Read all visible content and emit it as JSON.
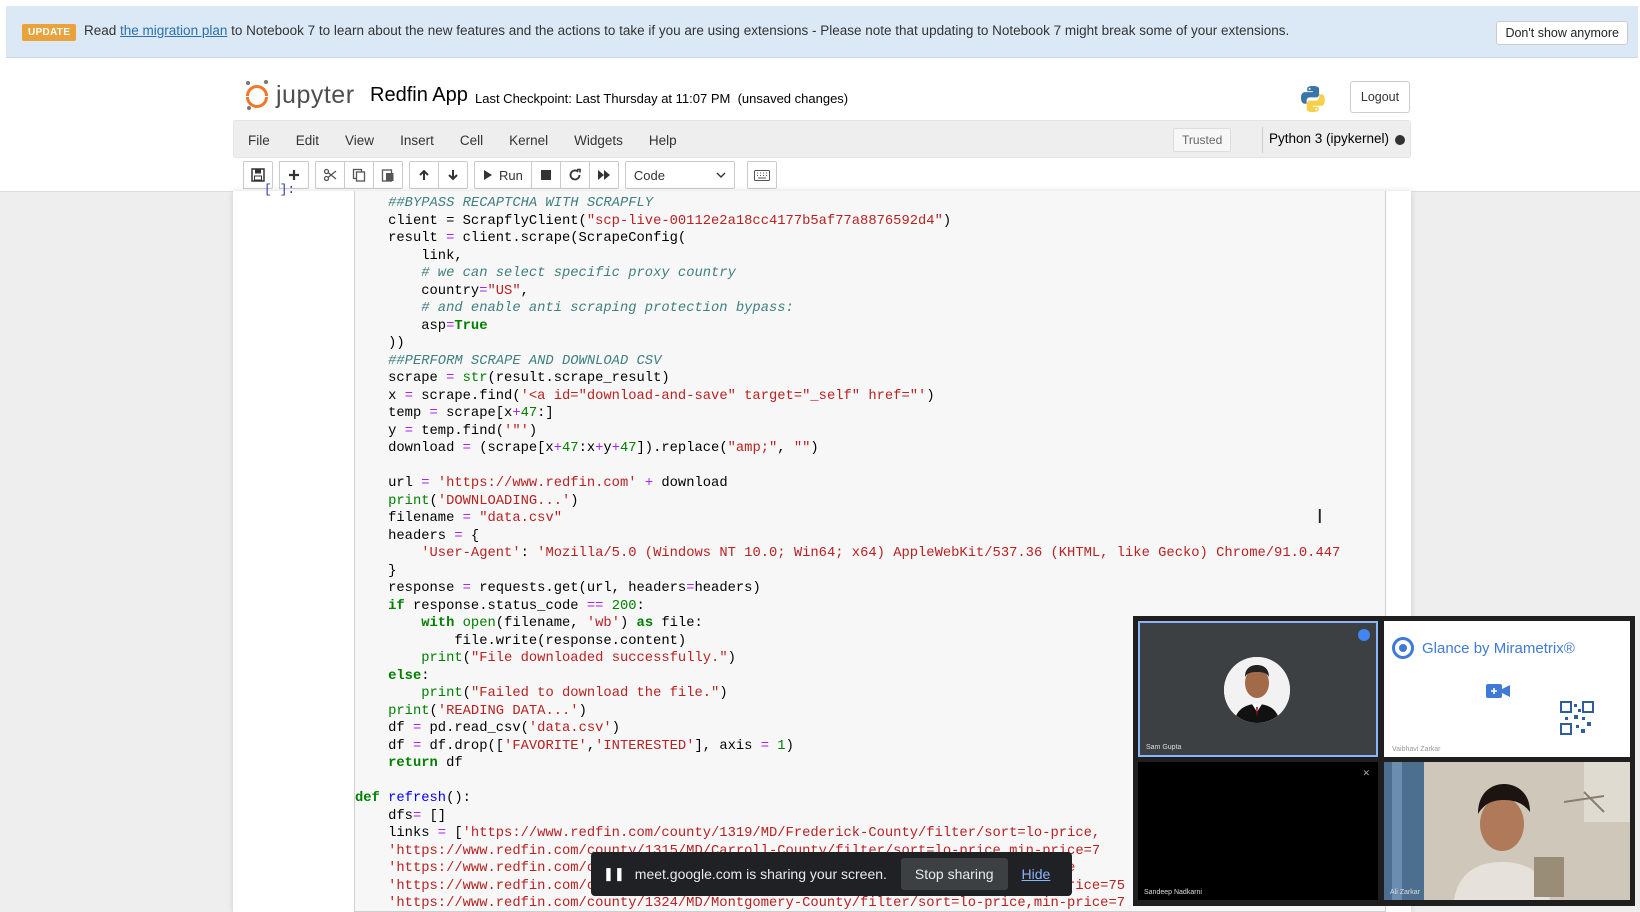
{
  "banner": {
    "badge": "UPDATE",
    "text_before": "Read ",
    "link_text": "the migration plan",
    "text_after": " to Notebook 7 to learn about the new features and the actions to take if you are using extensions - Please note that updating to Notebook 7 might break some of your extensions.",
    "dismiss_label": "Don't show anymore"
  },
  "header": {
    "logo_text": "jupyter",
    "notebook_name": "Redfin App",
    "checkpoint": "Last Checkpoint: Last Thursday at 11:07 PM",
    "unsaved": "(unsaved changes)",
    "logout_label": "Logout"
  },
  "menu": {
    "items": [
      "File",
      "Edit",
      "View",
      "Insert",
      "Cell",
      "Kernel",
      "Widgets",
      "Help"
    ],
    "trusted": "Trusted",
    "kernel": "Python 3 (ipykernel)"
  },
  "toolbar": {
    "run_label": "Run",
    "cell_type": "Code"
  },
  "cell": {
    "prompt": "[ ]:"
  },
  "code_lines": [
    [
      [
        "    ",
        ""
      ],
      [
        "##BYPASS RECAPTCHA WITH SCRAPFLY",
        "cm"
      ]
    ],
    [
      [
        "    client = ScrapflyClient(",
        ""
      ],
      [
        "\"scp-live-00112e2a18cc4177b5af77a8876592d4\"",
        "st"
      ],
      [
        ")",
        ""
      ]
    ],
    [
      [
        "    result ",
        ""
      ],
      [
        "=",
        "op"
      ],
      [
        " client.scrape(ScrapeConfig(",
        ""
      ]
    ],
    [
      [
        "        link,",
        ""
      ]
    ],
    [
      [
        "        ",
        ""
      ],
      [
        "# we can select specific proxy country",
        "cm"
      ]
    ],
    [
      [
        "        country",
        ""
      ],
      [
        "=",
        "op"
      ],
      [
        "\"US\"",
        "st"
      ],
      [
        ",",
        ""
      ]
    ],
    [
      [
        "        ",
        ""
      ],
      [
        "# and enable anti scraping protection bypass:",
        "cm"
      ]
    ],
    [
      [
        "        asp",
        ""
      ],
      [
        "=",
        "op"
      ],
      [
        "True",
        "kw"
      ]
    ],
    [
      [
        "    ))",
        ""
      ]
    ],
    [
      [
        "    ",
        ""
      ],
      [
        "##PERFORM SCRAPE AND DOWNLOAD CSV",
        "cm"
      ]
    ],
    [
      [
        "    scrape ",
        ""
      ],
      [
        "=",
        "op"
      ],
      [
        " ",
        ""
      ],
      [
        "str",
        "bi"
      ],
      [
        "(result.scrape_result)",
        ""
      ]
    ],
    [
      [
        "    x ",
        ""
      ],
      [
        "=",
        "op"
      ],
      [
        " scrape.find(",
        ""
      ],
      [
        "'<a id=\"download-and-save\" target=\"_self\" href=\"'",
        "st"
      ],
      [
        ")",
        ""
      ]
    ],
    [
      [
        "    temp ",
        ""
      ],
      [
        "=",
        "op"
      ],
      [
        " scrape[x",
        ""
      ],
      [
        "+",
        "op"
      ],
      [
        "47",
        "nu"
      ],
      [
        ":]",
        ""
      ]
    ],
    [
      [
        "    y ",
        ""
      ],
      [
        "=",
        "op"
      ],
      [
        " temp.find(",
        ""
      ],
      [
        "'\"'",
        "st"
      ],
      [
        ")",
        ""
      ]
    ],
    [
      [
        "    download ",
        ""
      ],
      [
        "=",
        "op"
      ],
      [
        " (scrape[x",
        ""
      ],
      [
        "+",
        "op"
      ],
      [
        "47",
        "nu"
      ],
      [
        ":x",
        ""
      ],
      [
        "+",
        "op"
      ],
      [
        "y",
        ""
      ],
      [
        "+",
        "op"
      ],
      [
        "47",
        "nu"
      ],
      [
        "]).replace(",
        ""
      ],
      [
        "\"amp;\"",
        "st"
      ],
      [
        ", ",
        ""
      ],
      [
        "\"\"",
        "st"
      ],
      [
        ")",
        ""
      ]
    ],
    [
      [
        "",
        ""
      ]
    ],
    [
      [
        "    url ",
        ""
      ],
      [
        "=",
        "op"
      ],
      [
        " ",
        ""
      ],
      [
        "'https://www.redfin.com'",
        "st"
      ],
      [
        " ",
        ""
      ],
      [
        "+",
        "op"
      ],
      [
        " download",
        ""
      ]
    ],
    [
      [
        "    ",
        ""
      ],
      [
        "print",
        "bi"
      ],
      [
        "(",
        ""
      ],
      [
        "'DOWNLOADING...'",
        "st"
      ],
      [
        ")",
        ""
      ]
    ],
    [
      [
        "    filename ",
        ""
      ],
      [
        "=",
        "op"
      ],
      [
        " ",
        ""
      ],
      [
        "\"data.csv\"",
        "st"
      ]
    ],
    [
      [
        "    headers ",
        ""
      ],
      [
        "=",
        "op"
      ],
      [
        " {",
        ""
      ]
    ],
    [
      [
        "        ",
        ""
      ],
      [
        "'User-Agent'",
        "st"
      ],
      [
        ": ",
        ""
      ],
      [
        "'Mozilla/5.0 (Windows NT 10.0; Win64; x64) AppleWebKit/537.36 (KHTML, like Gecko) Chrome/91.0.447",
        "st"
      ]
    ],
    [
      [
        "    }",
        ""
      ]
    ],
    [
      [
        "    response ",
        ""
      ],
      [
        "=",
        "op"
      ],
      [
        " requests.get(url, headers",
        ""
      ],
      [
        "=",
        "op"
      ],
      [
        "headers)",
        ""
      ]
    ],
    [
      [
        "    ",
        ""
      ],
      [
        "if",
        "kw"
      ],
      [
        " response.status_code ",
        ""
      ],
      [
        "==",
        "op"
      ],
      [
        " ",
        ""
      ],
      [
        "200",
        "nu"
      ],
      [
        ":",
        ""
      ]
    ],
    [
      [
        "        ",
        ""
      ],
      [
        "with",
        "kw"
      ],
      [
        " ",
        ""
      ],
      [
        "open",
        "bi"
      ],
      [
        "(filename, ",
        ""
      ],
      [
        "'wb'",
        "st"
      ],
      [
        ") ",
        ""
      ],
      [
        "as",
        "kw"
      ],
      [
        " file:",
        ""
      ]
    ],
    [
      [
        "            file.write(response.content)",
        ""
      ]
    ],
    [
      [
        "        ",
        ""
      ],
      [
        "print",
        "bi"
      ],
      [
        "(",
        ""
      ],
      [
        "\"File downloaded successfully.\"",
        "st"
      ],
      [
        ")",
        ""
      ]
    ],
    [
      [
        "    ",
        ""
      ],
      [
        "else",
        "kw"
      ],
      [
        ":",
        ""
      ]
    ],
    [
      [
        "        ",
        ""
      ],
      [
        "print",
        "bi"
      ],
      [
        "(",
        ""
      ],
      [
        "\"Failed to download the file.\"",
        "st"
      ],
      [
        ")",
        ""
      ]
    ],
    [
      [
        "    ",
        ""
      ],
      [
        "print",
        "bi"
      ],
      [
        "(",
        ""
      ],
      [
        "'READING DATA...'",
        "st"
      ],
      [
        ")",
        ""
      ]
    ],
    [
      [
        "    df ",
        ""
      ],
      [
        "=",
        "op"
      ],
      [
        " pd.read_csv(",
        ""
      ],
      [
        "'data.csv'",
        "st"
      ],
      [
        ")",
        ""
      ]
    ],
    [
      [
        "    df ",
        ""
      ],
      [
        "=",
        "op"
      ],
      [
        " df.drop([",
        ""
      ],
      [
        "'FAVORITE'",
        "st"
      ],
      [
        ",",
        ""
      ],
      [
        "'INTERESTED'",
        "st"
      ],
      [
        "], axis ",
        ""
      ],
      [
        "=",
        "op"
      ],
      [
        " ",
        ""
      ],
      [
        "1",
        "nu"
      ],
      [
        ")",
        ""
      ]
    ],
    [
      [
        "    ",
        ""
      ],
      [
        "return",
        "kw"
      ],
      [
        " df",
        ""
      ]
    ],
    [
      [
        "",
        ""
      ]
    ],
    [
      [
        "def",
        "kw"
      ],
      [
        " ",
        ""
      ],
      [
        "refresh",
        "fn"
      ],
      [
        "():",
        ""
      ]
    ],
    [
      [
        "    dfs",
        ""
      ],
      [
        "=",
        "op"
      ],
      [
        " []",
        ""
      ]
    ],
    [
      [
        "    links ",
        ""
      ],
      [
        "=",
        "op"
      ],
      [
        " [",
        ""
      ],
      [
        "'https://www.redfin.com/county/1319/MD/Frederick-County/filter/sort=lo-price,",
        "st"
      ]
    ],
    [
      [
        "    ",
        ""
      ],
      [
        "'https://www.redfin.com/county/1315/MD/Carroll-County/filter/sort=lo-price,min-price=7",
        "st"
      ]
    ],
    [
      [
        "    ",
        ""
      ],
      [
        "'https://www.redfin.com/county/1316/MD/Howard-County/filter/sort=lo-price,min-price",
        "st"
      ]
    ],
    [
      [
        "    ",
        ""
      ],
      [
        "'https://www.redfin.com/county/1317/MD/Baltimore-County/filter/sort=lo-price,min-price=75",
        "st"
      ]
    ],
    [
      [
        "    ",
        ""
      ],
      [
        "'https://www.redfin.com/county/1324/MD/Montgomery-County/filter/sort=lo-price,min-price=7",
        "st"
      ]
    ]
  ],
  "share": {
    "text": "meet.google.com is sharing your screen.",
    "stop_label": "Stop sharing",
    "hide_label": "Hide"
  },
  "meet": {
    "glance_title": "Glance by Mirametrix®"
  },
  "colors": {
    "banner_bg": "#dbe9f6",
    "badge": "#e8a33d",
    "code_bg": "#f7f7f7",
    "comment": "#408080",
    "string": "#ba2121",
    "keyword": "#008000"
  }
}
